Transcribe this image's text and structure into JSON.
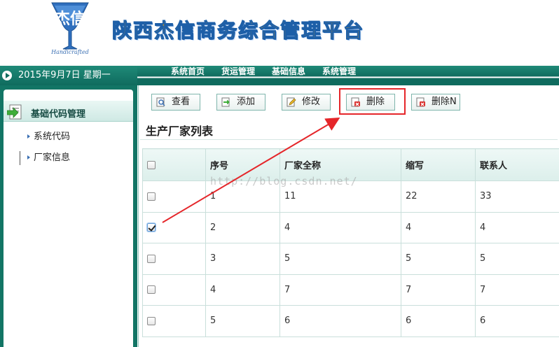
{
  "app": {
    "title": "陕西杰信商务综合管理平台",
    "logo_script": "Handicrafted",
    "logo_glyph": "杰信"
  },
  "date_bar": {
    "text": "2015年9月7日 星期一"
  },
  "nav": {
    "items": [
      "系统首页",
      "货运管理",
      "基础信息",
      "系统管理"
    ]
  },
  "sidebar": {
    "group_label": "基础代码管理",
    "items": [
      "系统代码",
      "厂家信息"
    ],
    "active_item": "厂家信息"
  },
  "toolbar": {
    "view_label": "查看",
    "add_label": "添加",
    "edit_label": "修改",
    "delete_label": "删除",
    "delete_n_label": "删除N"
  },
  "list": {
    "title": "生产厂家列表",
    "columns": [
      "序号",
      "厂家全称",
      "缩写",
      "联系人"
    ],
    "rows": [
      {
        "checked": false,
        "cells": [
          "1",
          "11",
          "22",
          "33"
        ]
      },
      {
        "checked": true,
        "cells": [
          "2",
          "4",
          "4",
          "4"
        ]
      },
      {
        "checked": false,
        "cells": [
          "3",
          "5",
          "5",
          "5"
        ]
      },
      {
        "checked": false,
        "cells": [
          "4",
          "7",
          "7",
          "7"
        ]
      },
      {
        "checked": false,
        "cells": [
          "5",
          "6",
          "6",
          "6"
        ]
      }
    ]
  },
  "watermark": "http://blog.csdn.net/",
  "colors": {
    "theme": "#127565",
    "title_fill": "#f0a20c",
    "title_stroke": "#1d5fa8",
    "annotation": "#e5262a"
  },
  "icons": {
    "view": "magnifier-page-icon",
    "add": "green-arrow-page-icon",
    "edit": "pencil-page-icon",
    "delete": "red-x-page-icon"
  }
}
